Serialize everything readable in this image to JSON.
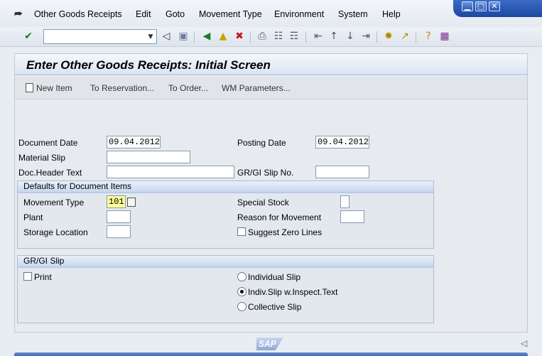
{
  "menubar": {
    "items": [
      "Other Goods Receipts",
      "Edit",
      "Goto",
      "Movement Type",
      "Environment",
      "System",
      "Help"
    ]
  },
  "window_controls": {
    "minimize": "▁",
    "maximize": "□",
    "close": "✕"
  },
  "toolbar": {
    "command_value": "",
    "icons": [
      "enter-icon",
      "save-icon",
      "back-icon",
      "exit-icon",
      "cancel-icon",
      "print-icon",
      "find-icon",
      "find-next-icon",
      "first-page-icon",
      "previous-page-icon",
      "next-page-icon",
      "last-page-icon",
      "create-session-icon",
      "shortcut-icon",
      "help-icon",
      "layout-icon"
    ]
  },
  "title": "Enter Other Goods Receipts: Initial Screen",
  "app_toolbar": {
    "new_item": "New Item",
    "to_reservation": "To Reservation...",
    "to_order": "To Order...",
    "wm_parameters": "WM Parameters..."
  },
  "header": {
    "document_date_label": "Document Date",
    "document_date_value": "09.04.2012",
    "posting_date_label": "Posting Date",
    "posting_date_value": "09.04.2012",
    "material_slip_label": "Material Slip",
    "material_slip_value": "",
    "doc_header_text_label": "Doc.Header Text",
    "doc_header_text_value": "",
    "gr_gi_slip_no_label": "GR/GI Slip No.",
    "gr_gi_slip_no_value": ""
  },
  "defaults": {
    "title": "Defaults for Document Items",
    "movement_type_label": "Movement Type",
    "movement_type_value": "101",
    "special_stock_label": "Special Stock",
    "special_stock_value": "",
    "plant_label": "Plant",
    "plant_value": "",
    "reason_label": "Reason for Movement",
    "reason_value": "",
    "storage_location_label": "Storage Location",
    "storage_location_value": "",
    "suggest_zero_lines_label": "Suggest Zero Lines",
    "suggest_zero_lines_checked": false
  },
  "slip": {
    "title": "GR/GI Slip",
    "print_label": "Print",
    "print_checked": false,
    "options": [
      "Individual Slip",
      "Indiv.Slip w.Inspect.Text",
      "Collective Slip"
    ],
    "selected": "Indiv.Slip w.Inspect.Text"
  },
  "footer": {
    "logo_text": "SAP"
  }
}
